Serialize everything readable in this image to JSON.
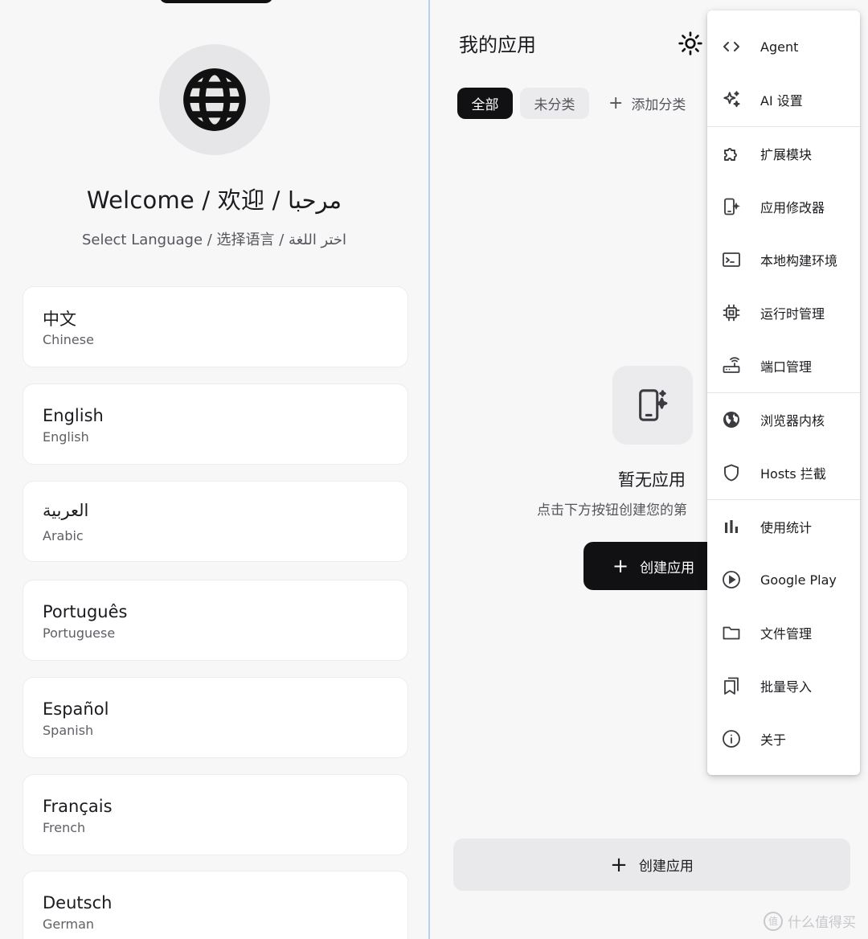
{
  "welcome": {
    "title": "Welcome / 欢迎 / مرحبا",
    "subtitle": "Select Language / 选择语言 / اختر اللغة"
  },
  "languages": [
    {
      "native": "中文",
      "english": "Chinese"
    },
    {
      "native": "English",
      "english": "English"
    },
    {
      "native": "العربية",
      "english": "Arabic"
    },
    {
      "native": "Português",
      "english": "Portuguese"
    },
    {
      "native": "Español",
      "english": "Spanish"
    },
    {
      "native": "Français",
      "english": "French"
    },
    {
      "native": "Deutsch",
      "english": "German"
    }
  ],
  "apps": {
    "title": "我的应用",
    "tabs": {
      "all": "全部",
      "uncategorized": "未分类",
      "add_category": "添加分类"
    },
    "empty_title": "暂无应用",
    "empty_subtitle": "点击下方按钮创建您的第",
    "create_button": "创建应用",
    "bottom_create": "创建应用"
  },
  "menu": {
    "items": [
      {
        "label": "Agent",
        "icon": "code-icon"
      },
      {
        "label": "AI 设置",
        "icon": "sparkle-icon"
      },
      {
        "label": "扩展模块",
        "icon": "puzzle-icon"
      },
      {
        "label": "应用修改器",
        "icon": "phone-edit-icon"
      },
      {
        "label": "本地构建环境",
        "icon": "terminal-icon"
      },
      {
        "label": "运行时管理",
        "icon": "chip-icon"
      },
      {
        "label": "端口管理",
        "icon": "router-icon"
      },
      {
        "label": "浏览器内核",
        "icon": "globe-icon"
      },
      {
        "label": "Hosts 拦截",
        "icon": "shield-icon"
      },
      {
        "label": "使用统计",
        "icon": "bar-chart-icon"
      },
      {
        "label": "Google Play",
        "icon": "play-circle-icon"
      },
      {
        "label": "文件管理",
        "icon": "folder-icon"
      },
      {
        "label": "批量导入",
        "icon": "bookmarks-icon"
      },
      {
        "label": "关于",
        "icon": "info-icon"
      }
    ]
  },
  "watermark": "什么值得买",
  "colors": {
    "accent": "#111113",
    "divider": "#b9cdf5",
    "card": "#ffffff",
    "background": "#f7f7f8"
  }
}
